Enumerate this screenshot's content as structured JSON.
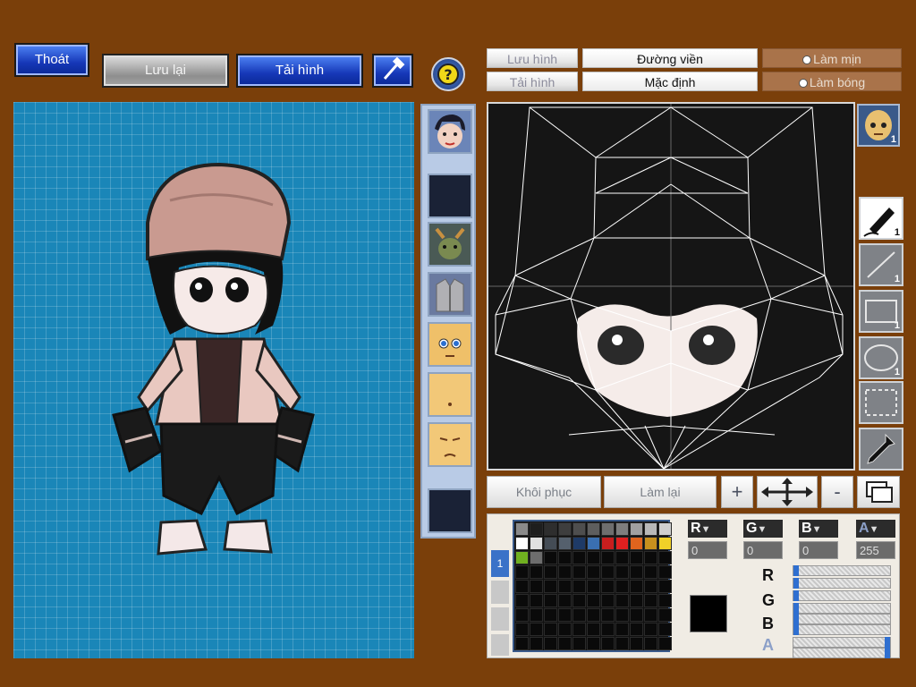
{
  "top_left": {
    "exit_label": "Thoát",
    "save_label": "Lưu lại",
    "load_label": "Tải hình",
    "tool_icon": "hammer-icon",
    "help_icon": "question-mark-icon"
  },
  "top_right": {
    "tab_save_image": "Lưu hình",
    "tab_load_image": "Tải hình",
    "outline_label": "Đường viền",
    "default_label": "Mặc định",
    "smooth_label": "Làm mịn",
    "shade_label": "Làm bóng"
  },
  "part_slots": [
    {
      "name": "hair-face-portrait"
    },
    {
      "name": "empty-slot"
    },
    {
      "name": "goat-mask"
    },
    {
      "name": "gray-jacket"
    },
    {
      "name": "blue-eyes-face"
    },
    {
      "name": "blank-face"
    },
    {
      "name": "frown-face"
    },
    {
      "name": "empty-slot"
    }
  ],
  "head_thumbnail": {
    "icon": "bald-head-icon",
    "count": "1"
  },
  "tools": [
    {
      "icon": "pen-icon",
      "count": "1"
    },
    {
      "icon": "line-icon",
      "count": "1"
    },
    {
      "icon": "rectangle-icon",
      "count": "1"
    },
    {
      "icon": "ellipse-icon",
      "count": "1"
    },
    {
      "icon": "selection-icon",
      "count": ""
    },
    {
      "icon": "eyedropper-icon",
      "count": ""
    }
  ],
  "edit_bar": {
    "restore_label": "Khôi phục",
    "redo_label": "Làm lại",
    "zoom_in": "+",
    "zoom_out": "-",
    "move_icon": "move-arrows-icon",
    "layers_icon": "layers-icon"
  },
  "palette": {
    "colors": [
      "#8a8a8a",
      "#1e1e1e",
      "#2e2e2e",
      "#3e3e3e",
      "#4e4e4e",
      "#5e5e5e",
      "#6e6e6e",
      "#7e7e7e",
      "#a0a0a0",
      "#b8b8b8",
      "#cfcfcf",
      "#ffffff",
      "#e0e0e0",
      "#444c55",
      "#55606d",
      "#1e3a66",
      "#3a6fb0",
      "#c81e1e",
      "#e02020",
      "#e0641e",
      "#c8901e",
      "#f0d028",
      "#70b020",
      "#6d6d6d"
    ],
    "side_tab": "1"
  },
  "rgba": {
    "r_label": "R",
    "g_label": "G",
    "b_label": "B",
    "a_label": "A",
    "r": "0",
    "g": "0",
    "b": "0",
    "a": "255",
    "current_color": "#000000"
  }
}
